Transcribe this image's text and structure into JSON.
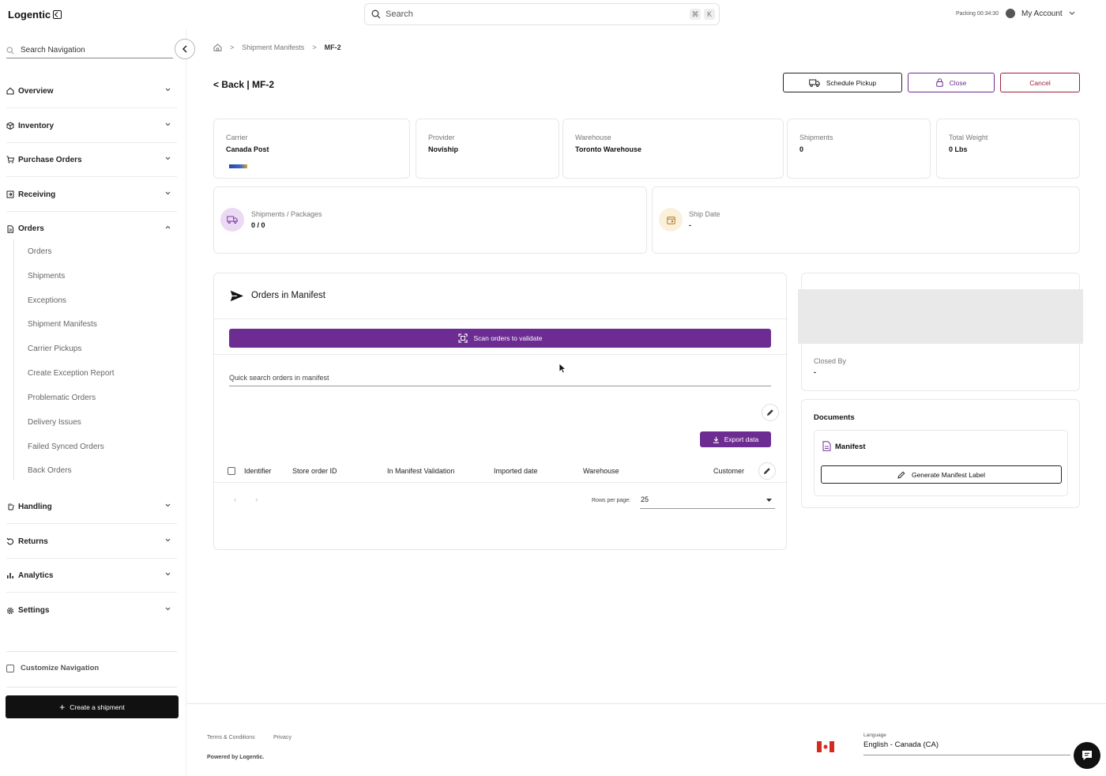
{
  "app": {
    "name": "Logentic"
  },
  "topbar": {
    "search_label": "Search",
    "shortcut_keys": [
      "⌘",
      "K"
    ],
    "packing_timer": "Packing 00:34:30",
    "account_label": "My Account"
  },
  "sidebar": {
    "search_placeholder": "Search Navigation",
    "groups": [
      {
        "label": "Overview"
      },
      {
        "label": "Inventory"
      },
      {
        "label": "Purchase Orders"
      },
      {
        "label": "Receiving"
      },
      {
        "label": "Orders"
      },
      {
        "label": "Handling"
      },
      {
        "label": "Returns"
      },
      {
        "label": "Analytics"
      },
      {
        "label": "Settings"
      }
    ],
    "orders_subitems": [
      "Orders",
      "Shipments",
      "Exceptions",
      "Shipment Manifests",
      "Carrier Pickups",
      "Create Exception Report",
      "Problematic Orders",
      "Delivery Issues",
      "Failed Synced Orders",
      "Back Orders"
    ],
    "customize_label": "Customize Navigation",
    "create_button": "Create a shipment"
  },
  "breadcrumb": {
    "parent": "Shipment Manifests",
    "current": "MF-2"
  },
  "header": {
    "title": "< Back | MF-2",
    "schedule_pickup": "Schedule Pickup",
    "close": "Close",
    "cancel": "Cancel"
  },
  "summary": {
    "carrier": {
      "label": "Carrier",
      "value": "Canada Post"
    },
    "provider": {
      "label": "Provider",
      "value": "Noviship"
    },
    "warehouse": {
      "label": "Warehouse",
      "value": "Toronto Warehouse"
    },
    "shipments": {
      "label": "Shipments",
      "value": "0"
    },
    "total_weight": {
      "label": "Total Weight",
      "value": "0 Lbs"
    },
    "shipments_packages": {
      "label": "Shipments / Packages",
      "value": "0 / 0"
    },
    "ship_date": {
      "label": "Ship Date",
      "value": "-"
    }
  },
  "orders_manifest": {
    "title": "Orders in Manifest",
    "scan_button": "Scan orders to validate",
    "quick_search_placeholder": "Quick search orders in manifest",
    "export_button": "Export data",
    "columns": [
      "Identifier",
      "Store order ID",
      "In Manifest Validation",
      "Imported date",
      "Warehouse",
      "Customer"
    ],
    "rows_per_page_label": "Rows per page:",
    "rows_per_page_value": "25"
  },
  "closed_info": {
    "label": "Closed By",
    "value": "-"
  },
  "documents": {
    "title": "Documents",
    "item_label": "Manifest",
    "generate_button": "Generate Manifest Label"
  },
  "footer": {
    "terms": "Terms & Conditions",
    "privacy": "Privacy",
    "powered": "Powered by Logentic.",
    "language_label": "Language",
    "language_value": "English - Canada (CA)"
  },
  "colors": {
    "primary": "#6c2c91",
    "cancel": "#a0203a",
    "close": "#6c2c91"
  }
}
